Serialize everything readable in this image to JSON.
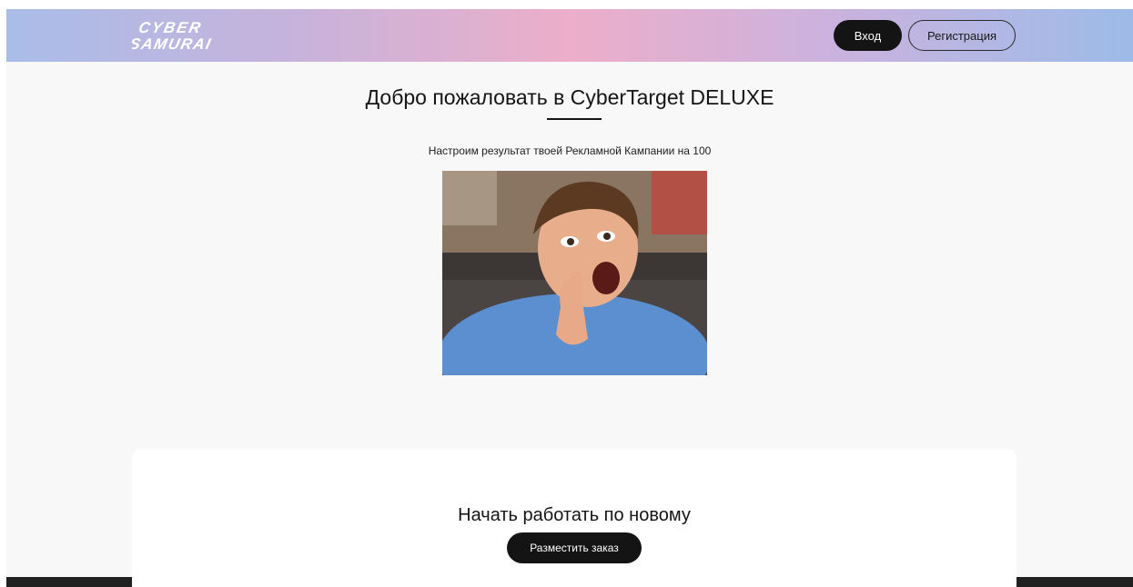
{
  "header": {
    "logo_line1": "CYBER",
    "logo_line2": "SAMURAI",
    "login_label": "Вход",
    "register_label": "Регистрация"
  },
  "hero": {
    "title": "Добро пожаловать в CyberTarget DELUXE",
    "subtitle": "Настроим результат твоей Рекламной Кампании на 100"
  },
  "cta": {
    "title": "Начать работать по новому",
    "button_label": "Разместить заказ"
  },
  "colors": {
    "header_gradient_left": "#a9bde8",
    "header_gradient_center": "#ecaec9",
    "header_gradient_right": "#9dbbe8",
    "button_dark": "#141414",
    "page_bg": "#f8f8f8"
  }
}
